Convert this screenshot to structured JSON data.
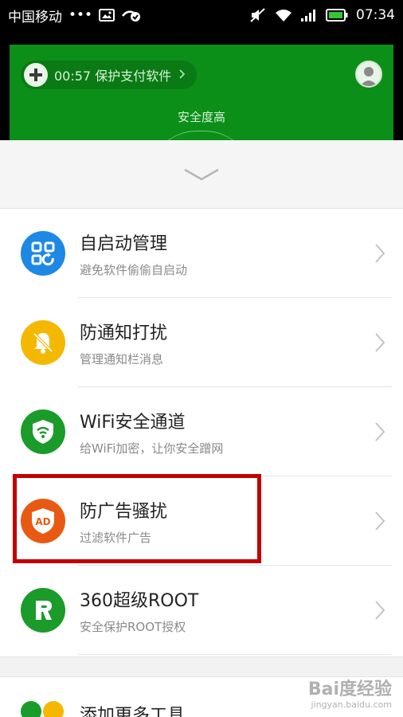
{
  "status_bar": {
    "carrier": "中国移动",
    "dots": "•••",
    "time": "07:34"
  },
  "header": {
    "promo_text": "00:57 保护支付软件",
    "safety_level": "安全度高",
    "green_color": "#0b8f18"
  },
  "list": [
    {
      "title": "自启动管理",
      "subtitle": "避免软件偷偷自启动",
      "icon": "grid-refresh-icon",
      "color": "#1e88e5"
    },
    {
      "title": "防通知打扰",
      "subtitle": "管理通知栏消息",
      "icon": "bell-off-icon",
      "color": "#f5b800"
    },
    {
      "title": "WiFi安全通道",
      "subtitle": "给WiFi加密，让你安全蹭网",
      "icon": "wifi-shield-icon",
      "color": "#1a9b2a"
    },
    {
      "title": "防广告骚扰",
      "subtitle": "过滤软件广告",
      "icon": "ad-shield-icon",
      "icon_text": "AD",
      "color": "#e85a14"
    },
    {
      "title": "360超级ROOT",
      "subtitle": "安全保护ROOT授权",
      "icon": "root-icon",
      "color": "#1a9b2a"
    }
  ],
  "bottom_item": {
    "title": "添加更多工具"
  },
  "watermark": {
    "text": "Bai度经验",
    "sub": "jingyan.baidu.com"
  },
  "highlight_color": "#c20000"
}
